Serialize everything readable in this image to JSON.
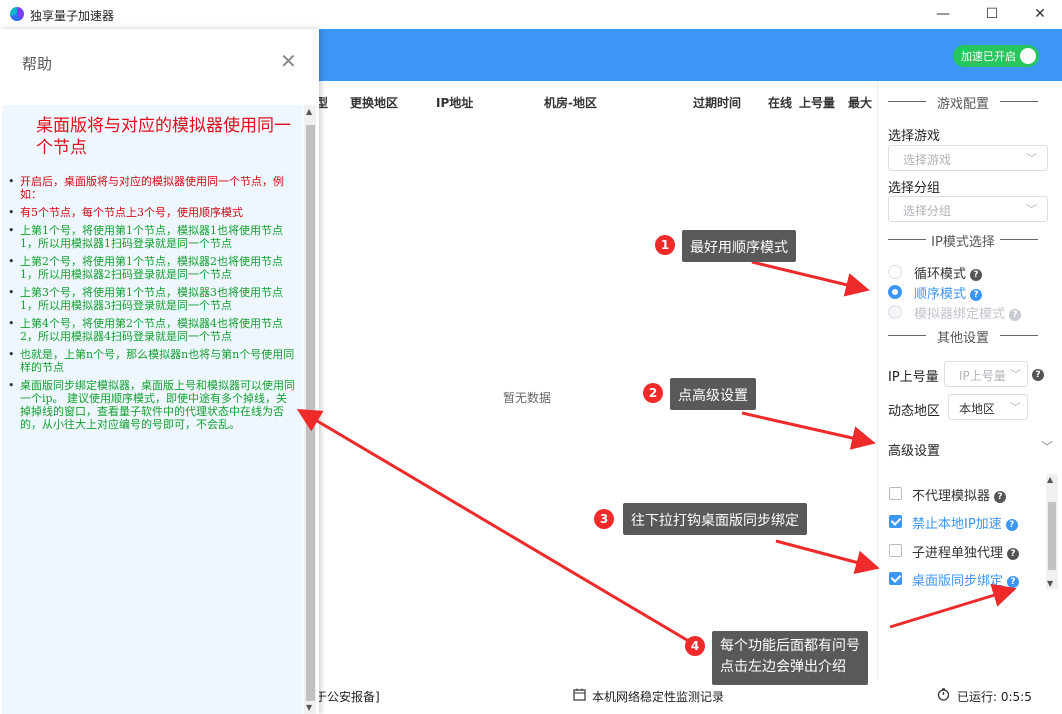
{
  "window": {
    "title": "独享量子加速器",
    "minimize": "—",
    "maximize": "☐",
    "close": "✕"
  },
  "header": {
    "toggle_label": "加速已开启"
  },
  "table": {
    "columns": [
      "型",
      "更换地区",
      "IP地址",
      "机房-地区",
      "过期时间",
      "在线",
      "上号量",
      "最大"
    ],
    "empty": "暂无数据"
  },
  "bottom": {
    "left": "于公安报备]",
    "center": "本机网络稳定性监测记录",
    "right": "已运行: 0:5:5"
  },
  "right_panel": {
    "game_section": "游戏配置",
    "select_game_label": "选择游戏",
    "select_game_placeholder": "选择游戏",
    "select_group_label": "选择分组",
    "select_group_placeholder": "选择分组",
    "ip_mode_section": "IP模式选择",
    "modes": [
      {
        "label": "循环模式",
        "state": "off"
      },
      {
        "label": "顺序模式",
        "state": "selected"
      },
      {
        "label": "模拟器绑定模式",
        "state": "disabled"
      }
    ],
    "other_section": "其他设置",
    "ip_limit_label": "IP上号量",
    "ip_limit_placeholder": "IP上号量",
    "dynamic_region_label": "动态地区",
    "dynamic_region_value": "本地区",
    "advanced_label": "高级设置",
    "options": [
      {
        "label": "不代理模拟器",
        "checked": false
      },
      {
        "label": "禁止本地IP加速",
        "checked": true
      },
      {
        "label": "子进程单独代理",
        "checked": false
      },
      {
        "label": "桌面版同步绑定",
        "checked": true
      }
    ]
  },
  "help": {
    "title": "帮助",
    "close": "✕",
    "heading": "桌面版将与对应的模拟器使用同一个节点",
    "items": [
      {
        "text": "开启后，桌面版将与对应的模拟器使用同一个节点，例如：",
        "color": "red"
      },
      {
        "text": "有5个节点，每个节点上3个号，使用顺序模式",
        "color": "red"
      },
      {
        "text": "上第1个号，将使用第1个节点，模拟器1也将使用节点1，所以用模拟器1扫码登录就是同一个节点",
        "color": "green"
      },
      {
        "text": "上第2个号，将使用第1个节点，模拟器2也将使用节点1，所以用模拟器2扫码登录就是同一个节点",
        "color": "green"
      },
      {
        "text": "上第3个号，将使用第1个节点，模拟器3也将使用节点1，所以用模拟器3扫码登录就是同一个节点",
        "color": "green"
      },
      {
        "text": "上第4个号，将使用第2个节点，模拟器4也将使用节点2，所以用模拟器4扫码登录就是同一个节点",
        "color": "green"
      },
      {
        "text": "也就是，上第n个号，那么模拟器n也将与第n个号使用同样的节点",
        "color": "green"
      },
      {
        "text": "桌面版同步绑定模拟器，桌面版上号和模拟器可以使用同一个ip。 建议使用顺序模式，即使中途有多个掉线，关掉掉线的窗口，查看量子软件中的代理状态中在线为否的，从小往大上对应编号的号即可，不会乱。",
        "color": "green"
      }
    ]
  },
  "callouts": [
    {
      "num": "1",
      "text": "最好用顺序模式"
    },
    {
      "num": "2",
      "text": "点高级设置"
    },
    {
      "num": "3",
      "text": "往下拉打钩桌面版同步绑定"
    },
    {
      "num": "4",
      "line1": "每个功能后面都有问号",
      "line2": "点击左边会弹出介绍"
    }
  ]
}
